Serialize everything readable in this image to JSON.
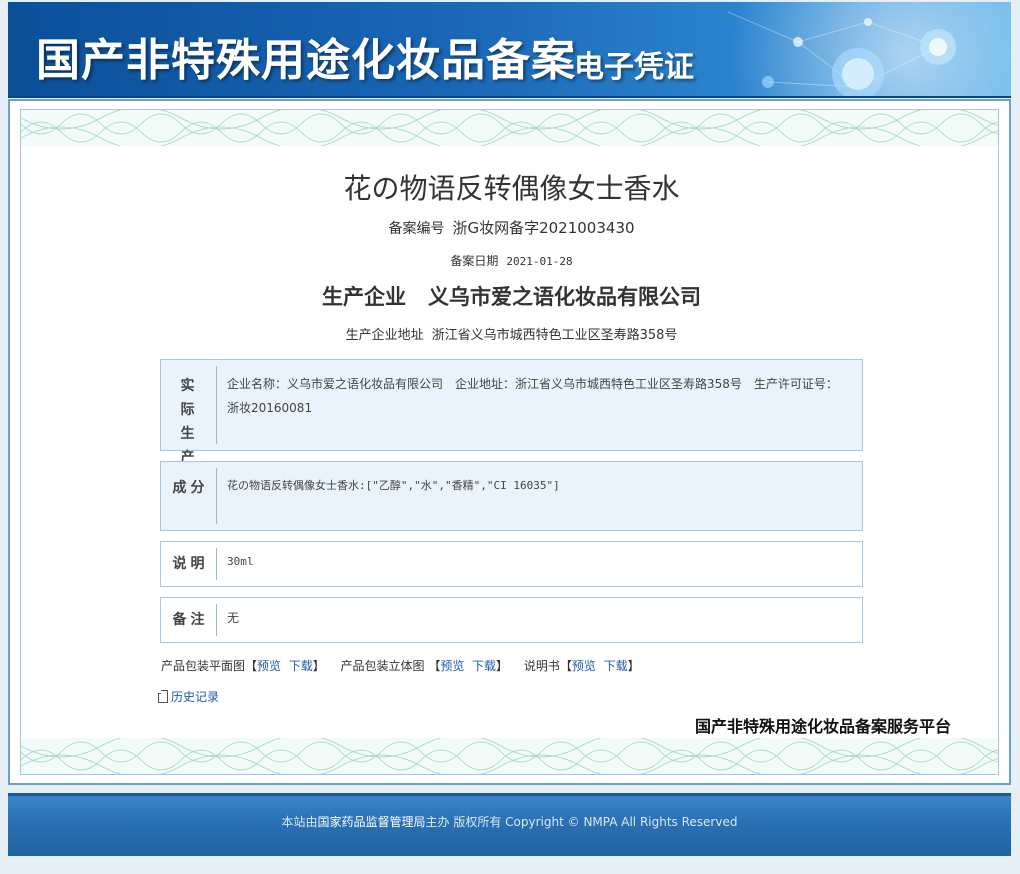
{
  "banner": {
    "title": "国产非特殊用途化妆品备案",
    "subtitle": "电子凭证"
  },
  "certificate": {
    "product_name": "花の物语反转偶像女士香水",
    "record_no_label": "备案编号",
    "record_no": "浙G妆网备字2021003430",
    "record_date_label": "备案日期",
    "record_date": "2021-01-28",
    "producer_label": "生产企业",
    "producer": "义乌市爱之语化妆品有限公司",
    "producer_address_label": "生产企业地址",
    "producer_address": "浙江省义乌市城西特色工业区圣寿路358号"
  },
  "sections": {
    "actual_producer": {
      "label": "实际生产企业",
      "content": "企业名称：义乌市爱之语化妆品有限公司　企业地址：浙江省义乌市城西特色工业区圣寿路358号　生产许可证号：浙妆20160081"
    },
    "ingredients": {
      "label": "成分",
      "content": "花の物语反转偶像女士香水:[\"乙醇\",\"水\",\"香精\",\"CI 16035\"]"
    },
    "description": {
      "label": "说明",
      "content": "30ml"
    },
    "remarks": {
      "label": "备注",
      "content": "无"
    }
  },
  "links": {
    "package_flat": "产品包装平面图",
    "package_3d": "产品包装立体图",
    "manual": "说明书",
    "preview": "预览",
    "download": "下载",
    "history": "历史记录"
  },
  "platform_name": "国产非特殊用途化妆品备案服务平台",
  "footer": {
    "prefix": "本站由",
    "agency": "国家药品监督管理局",
    "suffix": "主办 版权所有 Copyright © NMPA All Rights Reserved"
  },
  "colors": {
    "banner_blue": "#1a67b6",
    "link_blue": "#1c5ca8",
    "guilloche_green": "#9fd6c6",
    "box_fill": "#e8f3fb"
  }
}
